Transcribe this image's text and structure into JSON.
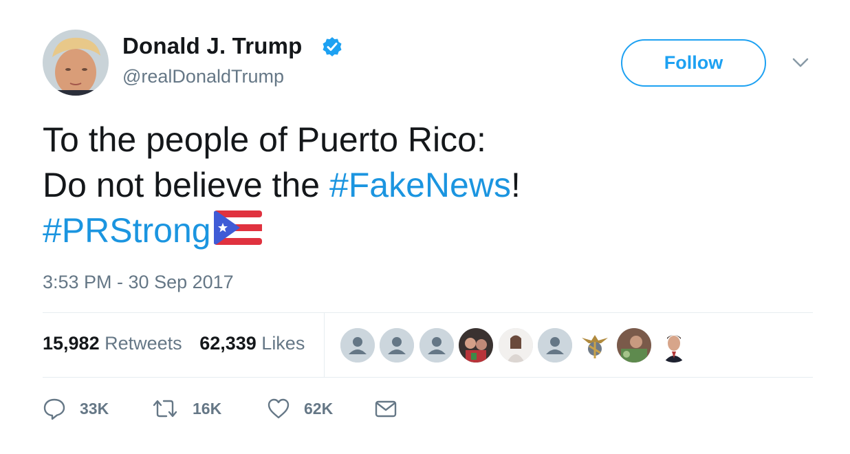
{
  "author": {
    "name": "Donald J. Trump",
    "handle": "@realDonaldTrump",
    "verified": true
  },
  "follow_button": {
    "label": "Follow"
  },
  "tweet": {
    "line1": "To the people of Puerto Rico:",
    "line2_prefix": "Do not believe the ",
    "line2_hashtag": "#FakeNews",
    "line2_suffix": "!",
    "line3_hashtag": "#PRStrong",
    "emoji": "puerto-rico-flag-icon"
  },
  "timestamp": "3:53 PM - 30 Sep 2017",
  "stats": {
    "retweets_count": "15,982",
    "retweets_label": "Retweets",
    "likes_count": "62,339",
    "likes_label": "Likes"
  },
  "likers": [
    "default-avatar",
    "default-avatar",
    "default-avatar",
    "photo-avatar",
    "photo-avatar",
    "default-avatar",
    "emblem-avatar",
    "photo-avatar",
    "photo-avatar"
  ],
  "actions": {
    "reply_count": "33K",
    "retweet_count": "16K",
    "like_count": "62K"
  },
  "colors": {
    "link": "#1b95e0",
    "brand": "#1da1f2",
    "muted": "#657786",
    "text": "#14171a"
  }
}
